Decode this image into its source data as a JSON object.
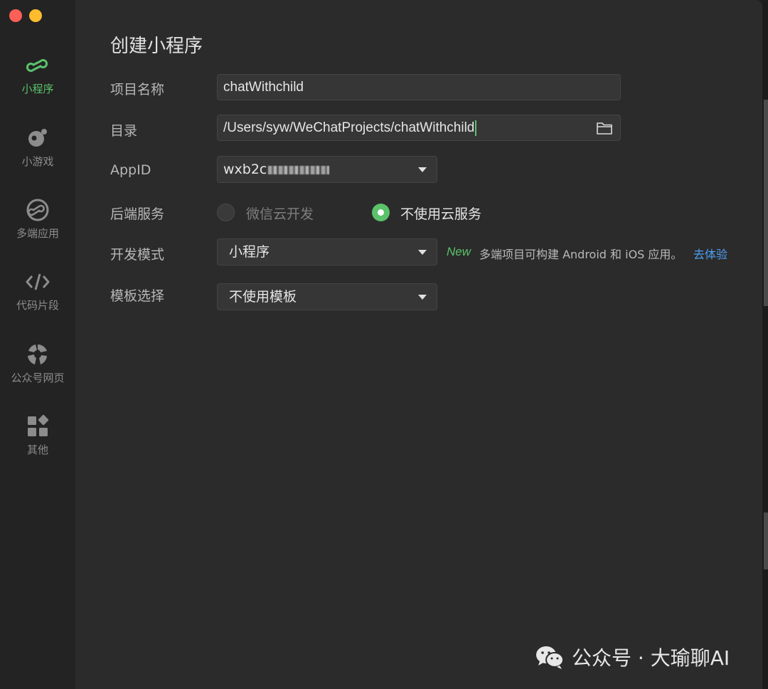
{
  "sidebar": {
    "items": [
      {
        "label": "小程序",
        "icon": "mini-program-icon",
        "active": true
      },
      {
        "label": "小游戏",
        "icon": "mini-game-icon",
        "active": false
      },
      {
        "label": "多端应用",
        "icon": "multi-platform-icon",
        "active": false
      },
      {
        "label": "代码片段",
        "icon": "code-icon",
        "active": false
      },
      {
        "label": "公众号网页",
        "icon": "official-account-icon",
        "active": false
      },
      {
        "label": "其他",
        "icon": "grid-icon",
        "active": false
      }
    ]
  },
  "form": {
    "title": "创建小程序",
    "project_name": {
      "label": "项目名称",
      "value": "chatWithchild"
    },
    "directory": {
      "label": "目录",
      "value": "/Users/syw/WeChatProjects/chatWithchild"
    },
    "appid": {
      "label": "AppID",
      "value_prefix": "wxb2c"
    },
    "backend": {
      "label": "后端服务",
      "options": [
        {
          "label": "微信云开发",
          "selected": false
        },
        {
          "label": "不使用云服务",
          "selected": true
        }
      ]
    },
    "dev_mode": {
      "label": "开发模式",
      "value": "小程序",
      "badge": "New",
      "hint": "多端项目可构建 Android 和 iOS 应用。",
      "link": "去体验"
    },
    "template": {
      "label": "模板选择",
      "value": "不使用模板"
    }
  },
  "watermark": {
    "text": "公众号 · 大瑜聊AI"
  },
  "colors": {
    "accent": "#5ac26b",
    "link": "#4f9ff5",
    "background": "#2b2b2b",
    "sidebar": "#232323"
  }
}
